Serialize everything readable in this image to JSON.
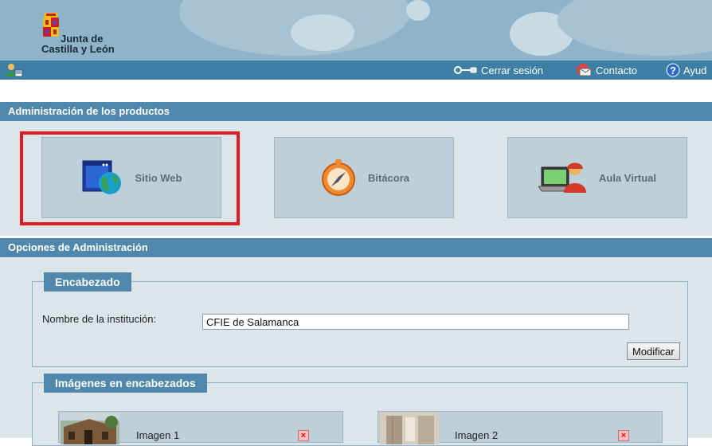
{
  "header": {
    "logo_line1": "Junta de",
    "logo_line2": "Castilla y León"
  },
  "toolbar": {
    "logout_label": "Cerrar sesión",
    "contact_label": "Contacto",
    "help_label": "Ayud"
  },
  "products": {
    "title": "Administración de los productos",
    "items": [
      {
        "label": "Sitio Web",
        "icon": "globe-window-icon"
      },
      {
        "label": "Bitácora",
        "icon": "compass-icon"
      },
      {
        "label": "Aula Virtual",
        "icon": "laptop-user-icon"
      }
    ]
  },
  "options": {
    "title": "Opciones de Administración"
  },
  "encabezado": {
    "legend": "Encabezado",
    "institution_label": "Nombre de la institución:",
    "institution_value": "CFIE de Salamanca",
    "modify_button": "Modificar"
  },
  "imagenes": {
    "legend": "Imágenes en encabezados",
    "items": [
      {
        "label": "Imagen 1"
      },
      {
        "label": "Imagen 2"
      }
    ]
  },
  "colors": {
    "bar": "#4f87ad",
    "toolbar": "#3e7fa6",
    "panel": "#dbe5ea",
    "highlight": "#e21a22"
  }
}
